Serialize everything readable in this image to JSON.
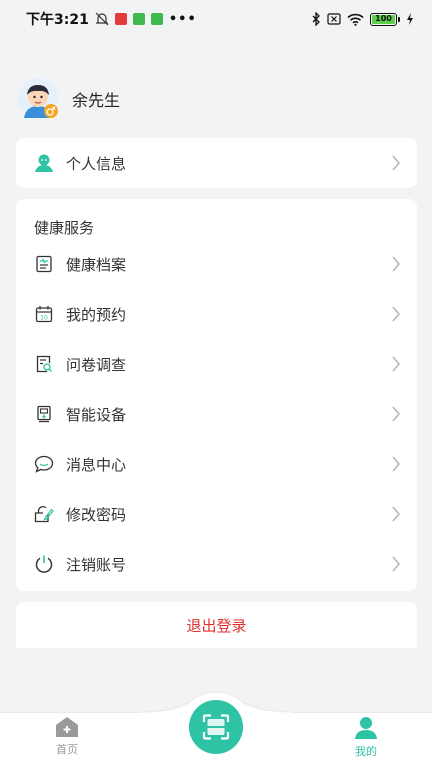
{
  "status_bar": {
    "time": "下午3:21",
    "dots": "•••",
    "battery": "100"
  },
  "profile": {
    "name": "余先生"
  },
  "personal": {
    "label": "个人信息"
  },
  "services": {
    "title": "健康服务",
    "items": [
      {
        "label": "健康档案",
        "icon": "health-record-icon"
      },
      {
        "label": "我的预约",
        "icon": "calendar-icon"
      },
      {
        "label": "问卷调查",
        "icon": "questionnaire-icon"
      },
      {
        "label": "智能设备",
        "icon": "device-icon"
      },
      {
        "label": "消息中心",
        "icon": "message-icon"
      },
      {
        "label": "修改密码",
        "icon": "lock-edit-icon"
      },
      {
        "label": "注销账号",
        "icon": "power-icon"
      }
    ]
  },
  "logout": {
    "label": "退出登录"
  },
  "nav": {
    "home": "首页",
    "mine": "我的"
  },
  "colors": {
    "accent": "#2fc3a6",
    "danger": "#e0312f",
    "nav_inactive": "#9a9a9a"
  }
}
